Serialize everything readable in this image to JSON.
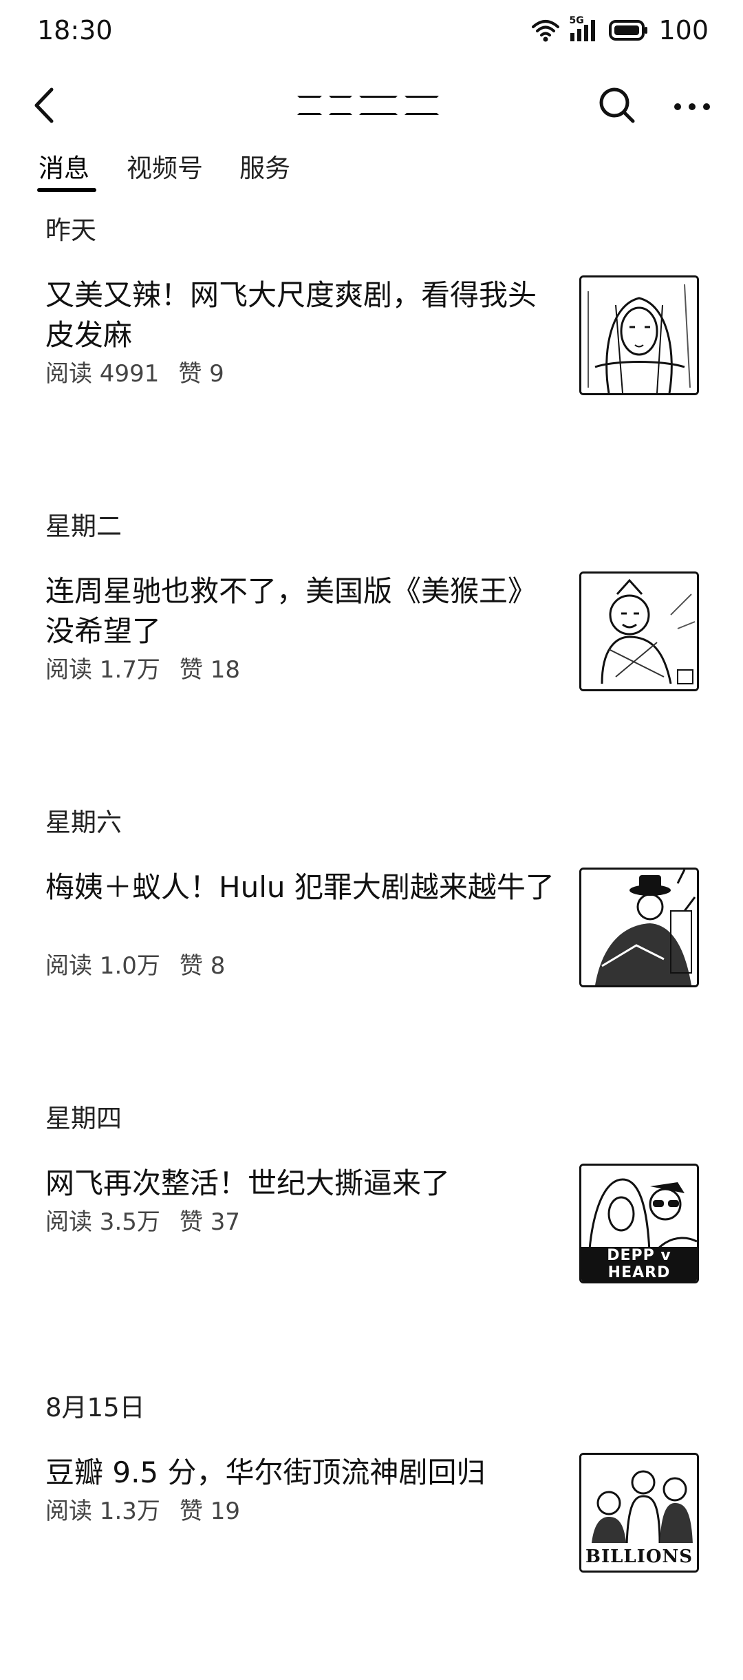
{
  "status_bar": {
    "time": "18:30",
    "network_label": "5G",
    "battery_level": "100",
    "icons": [
      "wifi-icon",
      "signal-icon",
      "battery-icon"
    ]
  },
  "nav": {
    "icons": [
      "back-arrow-icon",
      "search-icon",
      "more-icon"
    ]
  },
  "tabs": [
    {
      "label": "消息",
      "active": true
    },
    {
      "label": "视频号",
      "active": false
    },
    {
      "label": "服务",
      "active": false
    }
  ],
  "feed": [
    {
      "date": "昨天",
      "title": "又美又辣！网飞大尺度爽剧，看得我头皮发麻",
      "reads": "阅读 4991",
      "likes": "赞 9",
      "thumb_icon": "woman-portrait-image"
    },
    {
      "date": "星期二",
      "title": "连周星驰也救不了，美国版《美猴王》没希望了",
      "reads": "阅读 1.7万",
      "likes": "赞 18",
      "thumb_icon": "monkey-king-image"
    },
    {
      "date": "星期六",
      "title": "梅姨＋蚁人！Hulu 犯罪大剧越来越牛了",
      "reads": "阅读 1.0万",
      "likes": "赞 8",
      "thumb_icon": "man-in-hat-image"
    },
    {
      "date": "星期四",
      "title": "网飞再次整活！世纪大撕逼来了",
      "reads": "阅读 3.5万",
      "likes": "赞 37",
      "thumb_icon": "depp-heard-image",
      "thumb_text": "DEPP v HEARD"
    },
    {
      "date": "8月15日",
      "title": "豆瓣 9.5 分，华尔街顶流神剧回归",
      "reads": "阅读 1.3万",
      "likes": "赞 19",
      "thumb_icon": "billions-cast-image",
      "thumb_text": "BILLIONS"
    }
  ]
}
